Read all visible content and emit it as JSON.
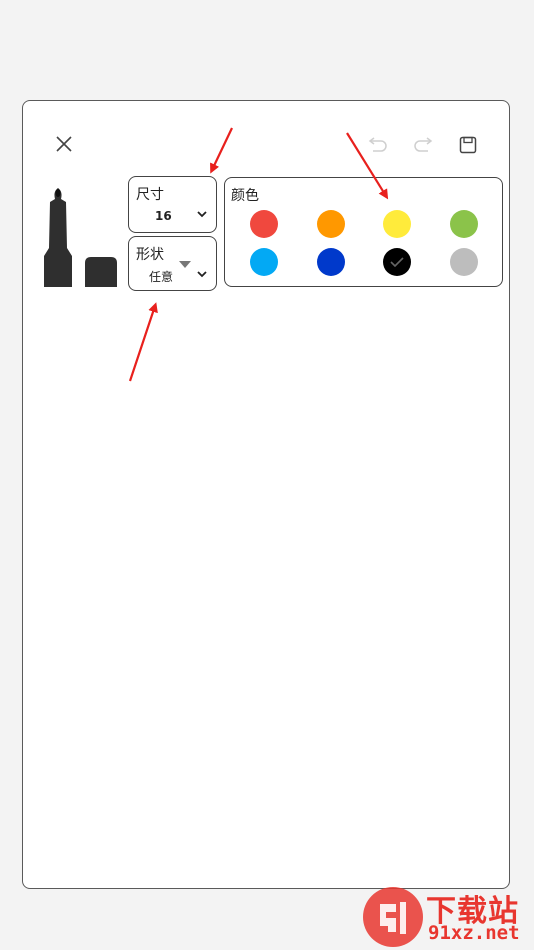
{
  "toolbar": {
    "close_icon": "close-icon",
    "undo_icon": "undo-icon",
    "redo_icon": "redo-icon",
    "save_icon": "save-icon"
  },
  "pens": [
    {
      "name": "marker-pen",
      "color": "#2f2f2f"
    },
    {
      "name": "eraser-pen",
      "color": "#2f2f2f"
    }
  ],
  "size": {
    "label": "尺寸",
    "value": "16"
  },
  "shape": {
    "label": "形状",
    "value": "任意"
  },
  "colors": {
    "label": "颜色",
    "selected": "#000000",
    "swatches": [
      "#f0483e",
      "#ff9800",
      "#ffeb3b",
      "#8bc34a",
      "#03a9f4",
      "#0039cb",
      "#000000",
      "#bdbdbd"
    ]
  },
  "annotation_color": "#e8201d",
  "watermark": {
    "cn": "下载站",
    "url": "91xz.net"
  }
}
